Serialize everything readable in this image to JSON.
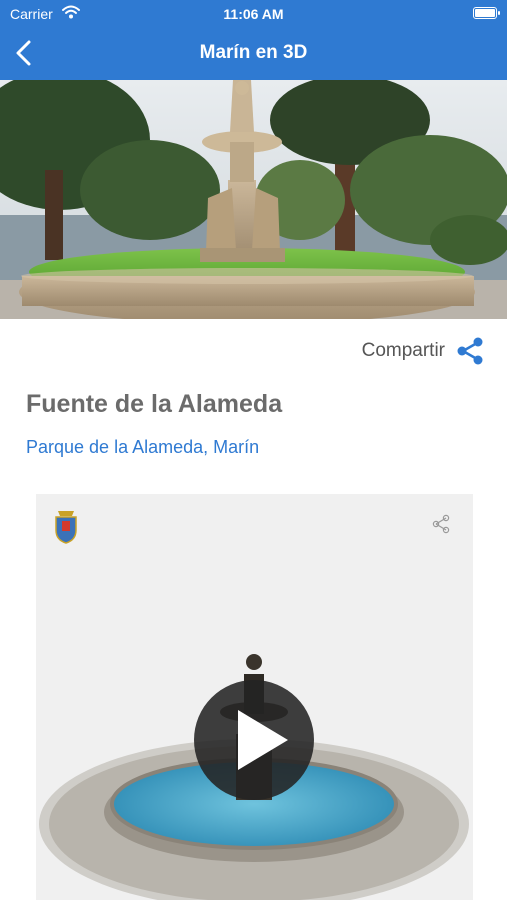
{
  "status_bar": {
    "carrier": "Carrier",
    "time": "11:06 AM"
  },
  "nav": {
    "title": "Marín en 3D",
    "back_icon": "chevron-left-icon"
  },
  "hero": {
    "alt_icon": "fountain-photo"
  },
  "share": {
    "label": "Compartir",
    "icon": "share-icon"
  },
  "place": {
    "title": "Fuente de la Alameda",
    "location": "Parque de la Alameda, Marín"
  },
  "viewer": {
    "logo_icon": "coat-of-arms-icon",
    "share_icon": "share-icon",
    "play_icon": "play-icon"
  },
  "colors": {
    "primary": "#2f7ad2",
    "title_gray": "#6b6b6b",
    "viewer_bg": "#f0f0f0"
  }
}
